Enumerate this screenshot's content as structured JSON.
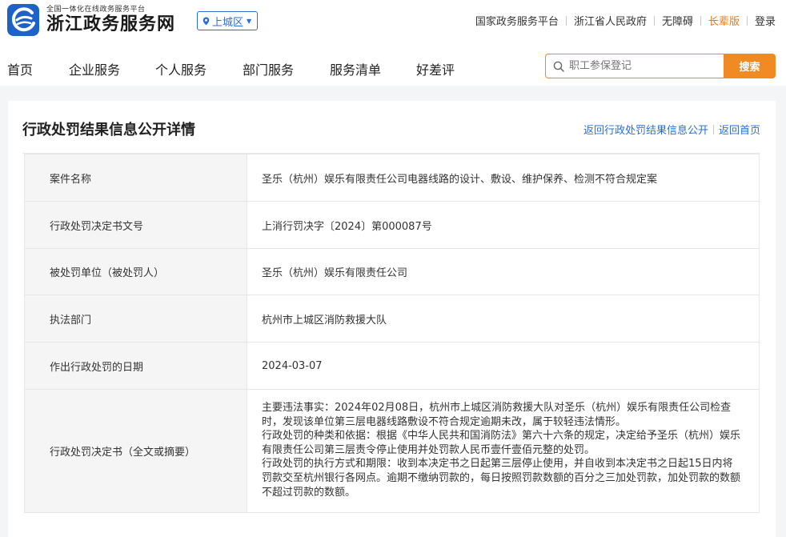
{
  "header": {
    "logo_small": "全国一体化在线政务服务平台",
    "logo_big": "浙江政务服务网",
    "region": "上城区",
    "links": [
      "国家政务服务平台",
      "浙江省人民政府",
      "无障碍",
      "长辈版",
      "登录"
    ]
  },
  "nav": {
    "items": [
      "首页",
      "企业服务",
      "个人服务",
      "部门服务",
      "服务清单",
      "好差评"
    ],
    "search_placeholder": "职工参保登记",
    "search_button": "搜索"
  },
  "page": {
    "title": "行政处罚结果信息公开详情",
    "back_list": "返回行政处罚结果信息公开",
    "back_home": "返回首页"
  },
  "rows": [
    {
      "label": "案件名称",
      "value": "圣乐（杭州）娱乐有限责任公司电器线路的设计、敷设、维护保养、检测不符合规定案"
    },
    {
      "label": "行政处罚决定书文号",
      "value": "上消行罚决字〔2024〕第000087号"
    },
    {
      "label": "被处罚单位（被处罚人）",
      "value": "圣乐（杭州）娱乐有限责任公司"
    },
    {
      "label": "执法部门",
      "value": "杭州市上城区消防救援大队"
    },
    {
      "label": "作出行政处罚的日期",
      "value": "2024-03-07"
    }
  ],
  "decision": {
    "label": "行政处罚决定书（全文或摘要）",
    "paragraphs": [
      "主要违法事实：2024年02月08日，杭州市上城区消防救援大队对圣乐（杭州）娱乐有限责任公司检查时，发现该单位第三层电器线路敷设不符合规定逾期未改，属于较轻违法情形。",
      "行政处罚的种类和依据：根据《中华人民共和国消防法》第六十六条的规定，决定给予圣乐（杭州）娱乐有限责任公司第三层责令停止使用并处罚款人民币壹仟壹佰元整的处罚。",
      "行政处罚的执行方式和期限：收到本决定书之日起第三层停止使用，并自收到本决定书之日起15日内将罚款交至杭州银行各网点。逾期不缴纳罚款的，每日按照罚款数额的百分之三加处罚款，加处罚款的数额不超过罚款的数额。"
    ]
  },
  "colors": {
    "brand_blue": "#1e62c8",
    "link_blue": "#2b6fd6",
    "accent_orange": "#f08a23"
  },
  "icons": [
    "logo-icon",
    "location-pin-icon",
    "chevron-down-icon",
    "search-icon"
  ]
}
